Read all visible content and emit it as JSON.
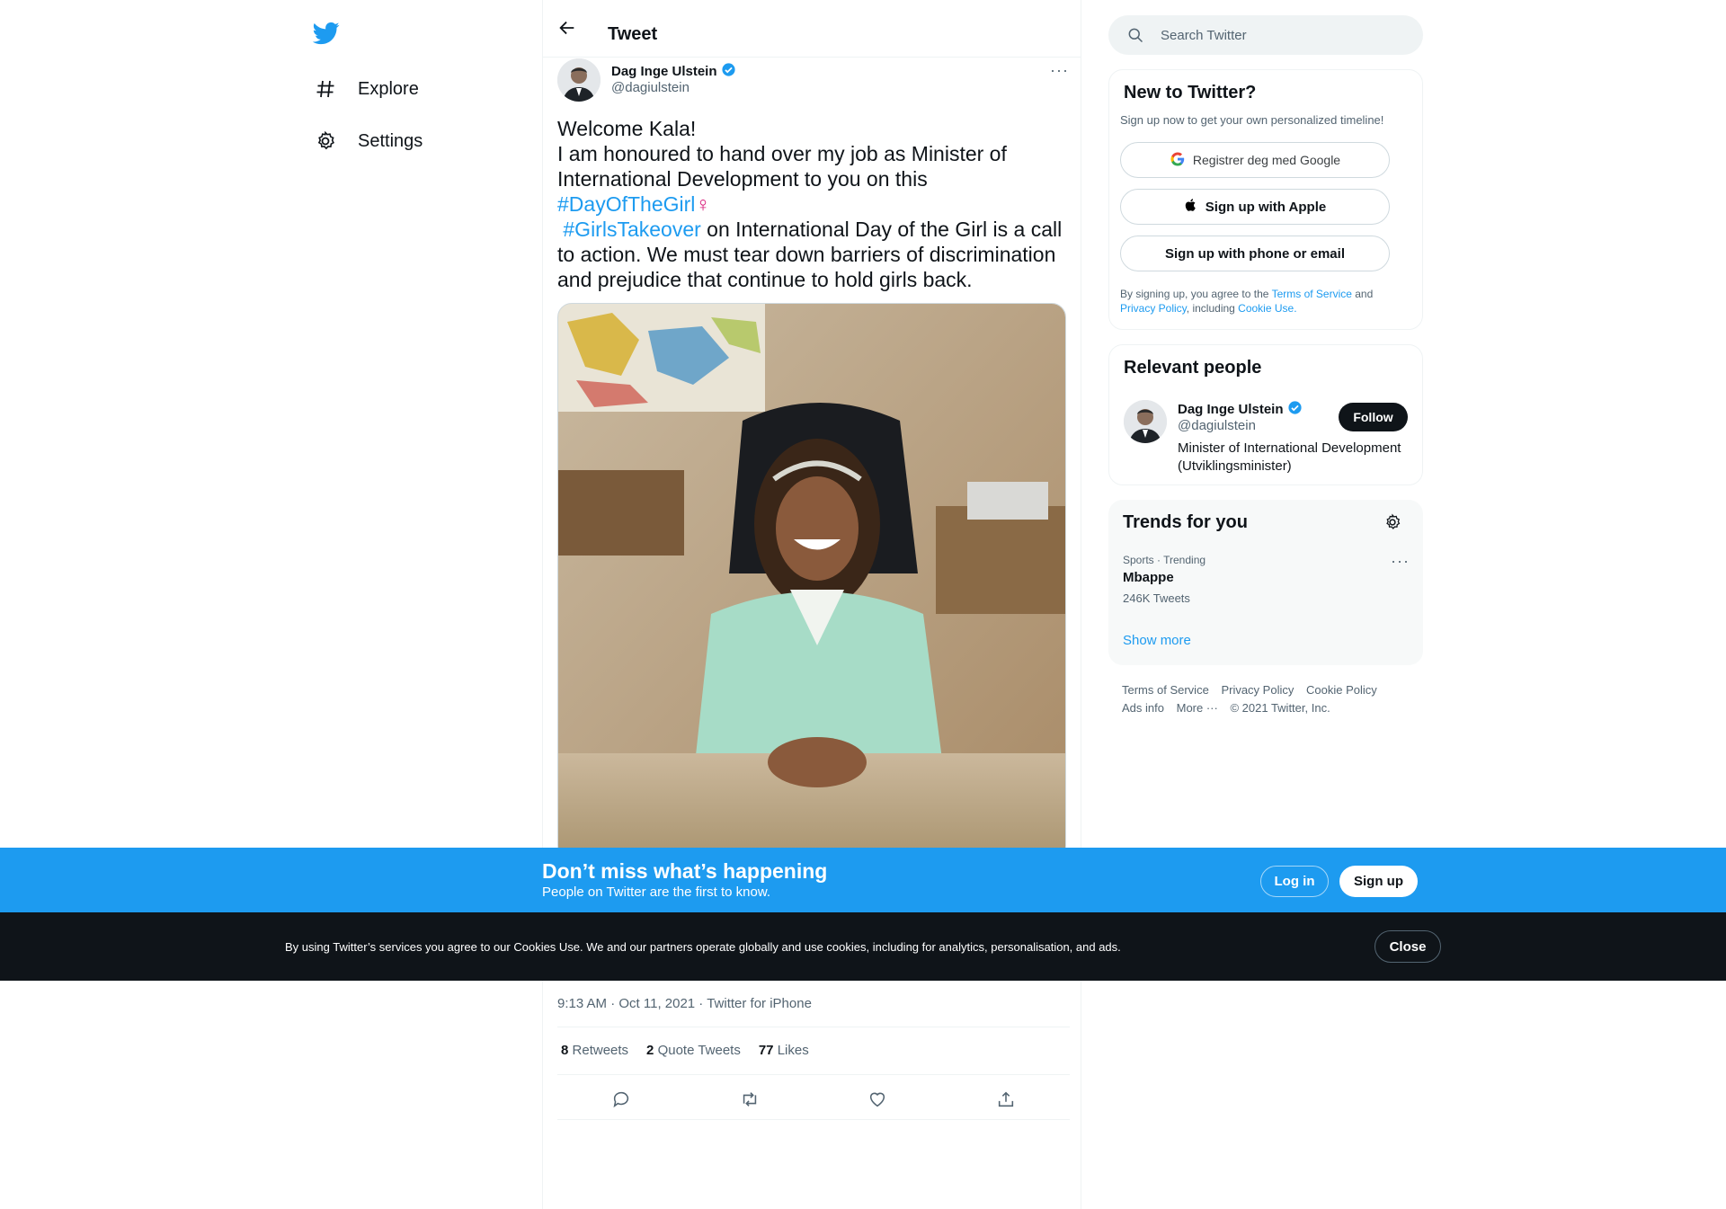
{
  "nav": {
    "explore_label": "Explore",
    "settings_label": "Settings"
  },
  "header": {
    "title": "Tweet"
  },
  "tweet": {
    "author_name": "Dag Inge Ulstein",
    "author_handle": "@dagiulstein",
    "more_icon": "···",
    "text_line1": "Welcome Kala!",
    "text_line2": "I am honoured to hand over my job as Minister of International Development to you on this",
    "hashtag1": "#DayOfTheGirl",
    "emoji": "♀",
    "hashtag2": "#GirlsTakeover",
    "text_tail": " on International Day of the Girl is a call to action. We must tear down barriers of discrimination and prejudice that continue to hold girls back.",
    "timestamp": "9:13 AM · Oct 11, 2021 · Twitter for iPhone",
    "retweets_count": "8",
    "retweets_label": "Retweets",
    "quotes_count": "2",
    "quotes_label": "Quote Tweets",
    "likes_count": "77",
    "likes_label": "Likes"
  },
  "search": {
    "placeholder": "Search Twitter"
  },
  "signup_card": {
    "title": "New to Twitter?",
    "subtitle": "Sign up now to get your own personalized timeline!",
    "google_label": "Registrer deg med Google",
    "apple_label": "Sign up with Apple",
    "phone_label": "Sign up with phone or email",
    "legal_prefix": "By signing up, you agree to the ",
    "legal_tos": "Terms of Service",
    "legal_and": " and",
    "legal_privacy": "Privacy Policy",
    "legal_including": ", including ",
    "legal_cookie": "Cookie Use."
  },
  "relevant_people": {
    "title": "Relevant people",
    "name": "Dag Inge Ulstein",
    "handle": "@dagiulstein",
    "follow_label": "Follow",
    "bio": "Minister of International Development (Utviklingsminister)"
  },
  "trends": {
    "title": "Trends for you",
    "items": [
      {
        "context": "Sports · Trending",
        "name": "Mbappe",
        "count": "246K Tweets"
      }
    ],
    "show_more": "Show more"
  },
  "footer": {
    "tos": "Terms of Service",
    "privacy": "Privacy Policy",
    "cookie": "Cookie Policy",
    "ads": "Ads info",
    "more": "More ···",
    "copyright": "© 2021 Twitter, Inc."
  },
  "banner": {
    "title": "Don’t miss what’s happening",
    "subtitle": "People on Twitter are the first to know.",
    "login_label": "Log in",
    "signup_label": "Sign up"
  },
  "cookie_bar": {
    "text": "By using Twitter’s services you agree to our Cookies Use. We and our partners operate globally and use cookies, including for analytics, personalisation, and ads.",
    "close_label": "Close"
  },
  "colors": {
    "accent": "#1d9bf0",
    "dark": "#0f1419",
    "muted": "#536471"
  }
}
